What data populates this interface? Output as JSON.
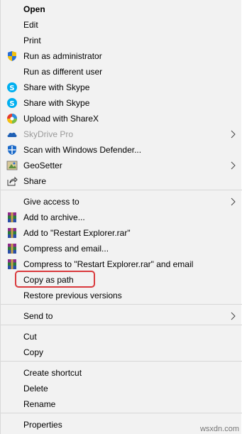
{
  "menu": {
    "items": [
      {
        "label": "Open",
        "icon": "none"
      },
      {
        "label": "Edit",
        "icon": "none"
      },
      {
        "label": "Print",
        "icon": "none"
      },
      {
        "label": "Run as administrator",
        "icon": "uac-shield-icon"
      },
      {
        "label": "Run as different user",
        "icon": "none"
      },
      {
        "label": "Share with Skype",
        "icon": "skype-icon"
      },
      {
        "label": "Share with Skype",
        "icon": "skype-icon"
      },
      {
        "label": "Upload with ShareX",
        "icon": "sharex-icon"
      },
      {
        "label": "SkyDrive Pro",
        "icon": "skydrive-icon"
      },
      {
        "label": "Scan with Windows Defender...",
        "icon": "defender-icon"
      },
      {
        "label": "GeoSetter",
        "icon": "geosetter-icon"
      },
      {
        "label": "Share",
        "icon": "share-icon"
      },
      {
        "label": "Give access to",
        "icon": "none"
      },
      {
        "label": "Add to archive...",
        "icon": "winrar-icon"
      },
      {
        "label": "Add to \"Restart Explorer.rar\"",
        "icon": "winrar-icon"
      },
      {
        "label": "Compress and email...",
        "icon": "winrar-icon"
      },
      {
        "label": "Compress to \"Restart Explorer.rar\" and email",
        "icon": "winrar-icon"
      },
      {
        "label": "Copy as path",
        "icon": "none"
      },
      {
        "label": "Restore previous versions",
        "icon": "none"
      },
      {
        "label": "Send to",
        "icon": "none"
      },
      {
        "label": "Cut",
        "icon": "none"
      },
      {
        "label": "Copy",
        "icon": "none"
      },
      {
        "label": "Create shortcut",
        "icon": "none"
      },
      {
        "label": "Delete",
        "icon": "none"
      },
      {
        "label": "Rename",
        "icon": "none"
      },
      {
        "label": "Properties",
        "icon": "none"
      }
    ]
  },
  "watermark": "wsxdn.com",
  "colors": {
    "menu_bg": "#f2f2f2",
    "highlight_border": "#d9393c",
    "skype": "#00aff0"
  }
}
